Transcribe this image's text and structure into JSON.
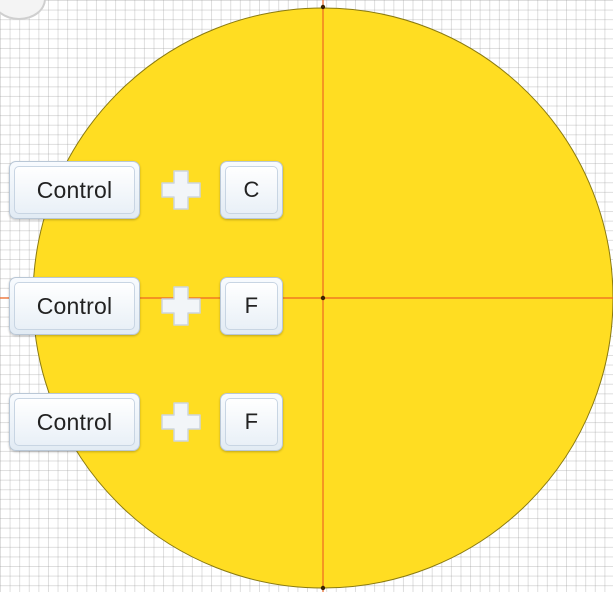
{
  "colors": {
    "circle_fill": "#FFDD22",
    "crosshair": "#EE6622"
  },
  "shortcuts": [
    {
      "modifier": "Control",
      "key": "C"
    },
    {
      "modifier": "Control",
      "key": "F"
    },
    {
      "modifier": "Control",
      "key": "F"
    }
  ]
}
